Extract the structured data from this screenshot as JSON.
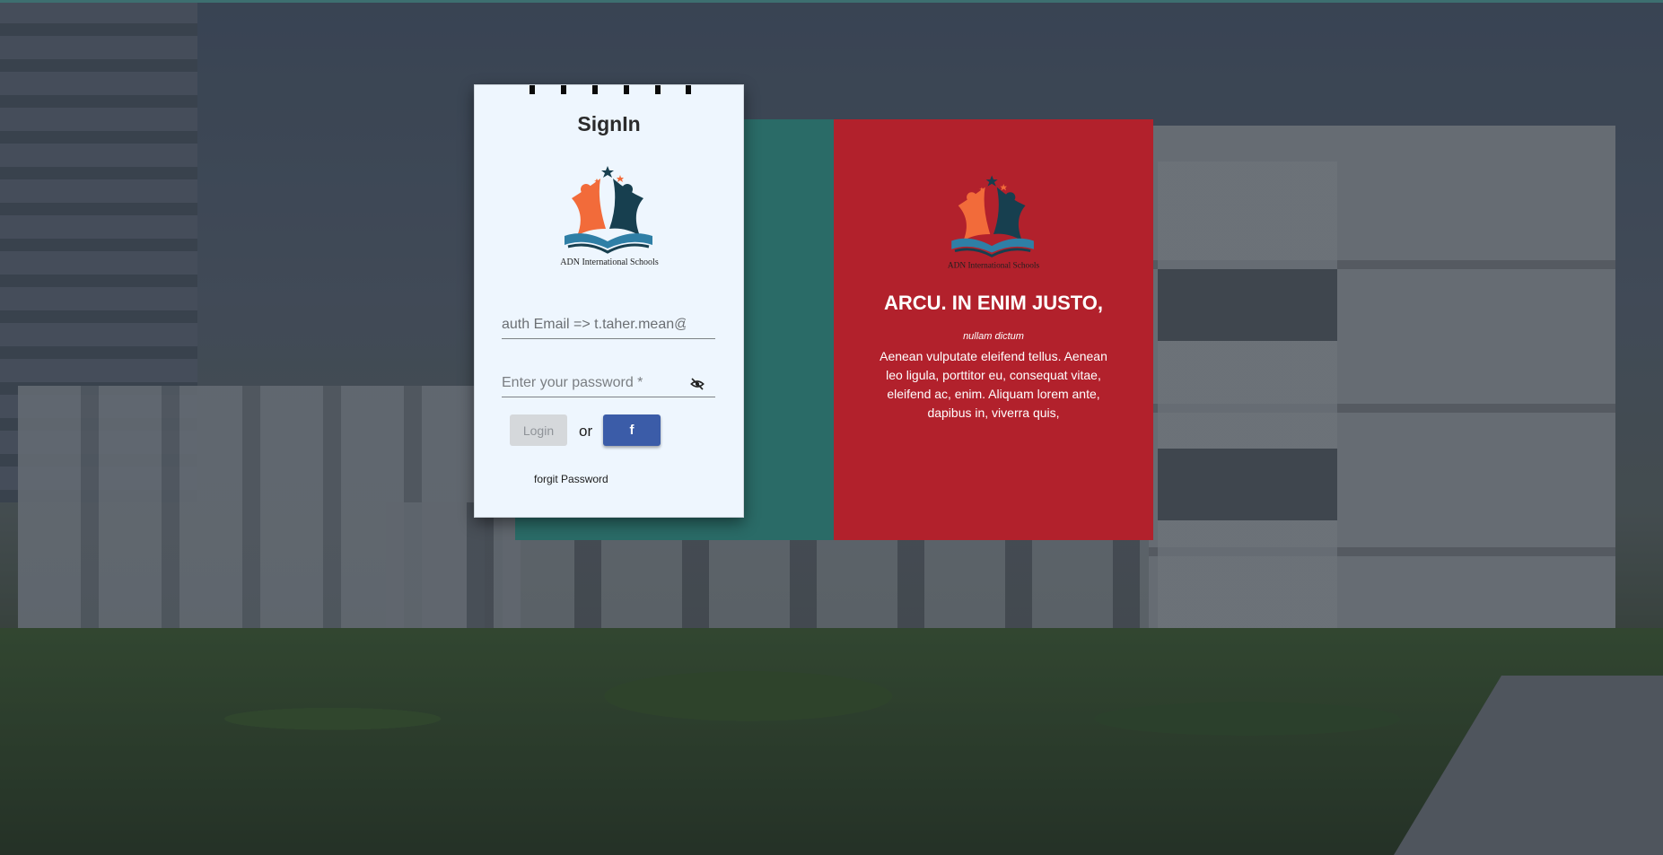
{
  "signin": {
    "title": "SignIn",
    "logo_text": "ADN International Schools",
    "email_value": "auth Email => t.taher.mean@gm...",
    "password_placeholder": "Enter your password *",
    "login_label": "Login",
    "or_label": "or",
    "facebook_icon": "facebook-f",
    "forgot_label": "forgit Password"
  },
  "promo": {
    "logo_text": "ADN International Schools",
    "heading": "ARCU. IN ENIM JUSTO,",
    "subtitle": "nullam dictum",
    "body": "Aenean vulputate eleifend tellus. Aenean leo ligula, porttitor eu, consequat vitae, eleifend ac, enim. Aliquam lorem ante, dapibus in, viverra quis,"
  },
  "colors": {
    "teal_panel": "#2a6b67",
    "red_panel": "#b2212c",
    "card_bg": "#eef6fe",
    "facebook_button": "#3b5ca8",
    "logo_orange": "#f26b3a",
    "logo_navy": "#173f4f"
  }
}
